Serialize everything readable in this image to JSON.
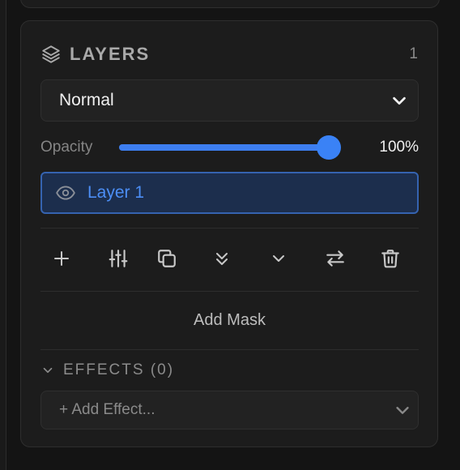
{
  "panel": {
    "title": "LAYERS",
    "count": "1",
    "icon": "layers-icon"
  },
  "blend_mode": {
    "selected": "Normal"
  },
  "opacity": {
    "label": "Opacity",
    "value_text": "100%",
    "level": 1.0
  },
  "layers": [
    {
      "name": "Layer 1",
      "visible": true,
      "selected": true
    }
  ],
  "toolbar": {
    "buttons": [
      "add-layer",
      "adjustments",
      "duplicate",
      "merge-down",
      "move-down",
      "swap",
      "delete"
    ]
  },
  "mask": {
    "label": "Add Mask"
  },
  "effects": {
    "title": "EFFECTS (0)",
    "add_placeholder": "+ Add Effect..."
  },
  "colors": {
    "accent": "#3a82f6",
    "selected_bg": "#1c2e4d",
    "panel_bg": "#1c1c1c"
  }
}
